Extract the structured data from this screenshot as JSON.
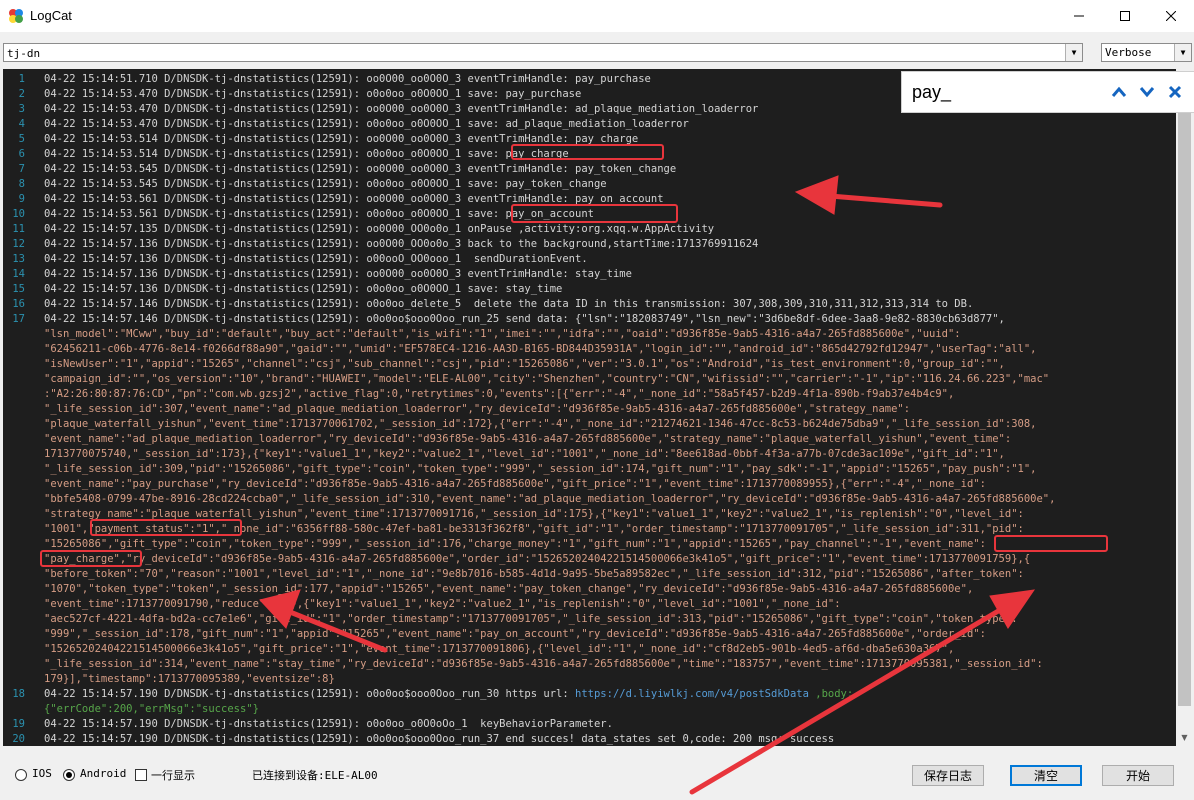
{
  "window": {
    "title": "LogCat"
  },
  "toolbar": {
    "device": "tj-dn",
    "level": "Verbose"
  },
  "find": {
    "query": "pay_"
  },
  "log": {
    "line_numbers": [
      "1",
      "2",
      "3",
      "4",
      "5",
      "6",
      "7",
      "8",
      "9",
      "10",
      "11",
      "12",
      "13",
      "14",
      "15",
      "16",
      "17",
      "18",
      "19",
      "20"
    ],
    "lines": [
      "04-22 15:14:51.710 D/DNSDK-tj-dnstatistics(12591): oo0O00_oo0O0O_3 eventTrimHandle: pay_purchase",
      "04-22 15:14:53.470 D/DNSDK-tj-dnstatistics(12591): o0o0oo_o0O0OO_1 save: pay_purchase",
      "04-22 15:14:53.470 D/DNSDK-tj-dnstatistics(12591): oo0O00_oo0O0O_3 eventTrimHandle: ad_plaque_mediation_loaderror",
      "04-22 15:14:53.470 D/DNSDK-tj-dnstatistics(12591): o0o0oo_o0O0OO_1 save: ad_plaque_mediation_loaderror",
      "04-22 15:14:53.514 D/DNSDK-tj-dnstatistics(12591): oo0O00_oo0O0O_3 eventTrimHandle: pay_charge",
      "04-22 15:14:53.514 D/DNSDK-tj-dnstatistics(12591): o0o0oo_o0O0OO_1 save: pay_charge",
      "04-22 15:14:53.545 D/DNSDK-tj-dnstatistics(12591): oo0O00_oo0O0O_3 eventTrimHandle: pay_token_change",
      "04-22 15:14:53.545 D/DNSDK-tj-dnstatistics(12591): o0o0oo_o0O0OO_1 save: pay_token_change",
      "04-22 15:14:53.561 D/DNSDK-tj-dnstatistics(12591): oo0O00_oo0O0O_3 eventTrimHandle: pay_on_account",
      "04-22 15:14:53.561 D/DNSDK-tj-dnstatistics(12591): o0o0oo_o0O0OO_1 save: pay_on_account",
      "04-22 15:14:57.135 D/DNSDK-tj-dnstatistics(12591): oo0O00_OO0o0o_1 onPause ,activity:org.xqq.w.AppActivity",
      "04-22 15:14:57.136 D/DNSDK-tj-dnstatistics(12591): oo0O00_OO0o0o_3 back to the background,startTime:1713769911624",
      "04-22 15:14:57.136 D/DNSDK-tj-dnstatistics(12591): o00ooO_OO0ooo_1  sendDurationEvent.",
      "04-22 15:14:57.136 D/DNSDK-tj-dnstatistics(12591): oo0O00_oo0O0O_3 eventTrimHandle: stay_time",
      "04-22 15:14:57.136 D/DNSDK-tj-dnstatistics(12591): o0o0oo_o0O0OO_1 save: stay_time",
      "04-22 15:14:57.146 D/DNSDK-tj-dnstatistics(12591): o0o0oo_delete_5  delete the data ID in this transmission: 307,308,309,310,311,312,313,314 to DB.",
      "04-22 15:14:57.146 D/DNSDK-tj-dnstatistics(12591): o0o0oo$ooo0Ooo_run_25 send data: {\"lsn\":\"182083749\",\"lsn_new\":\"3d6be8df-6dee-3aa8-9e82-8830cb63d877\","
    ],
    "json_lines": [
      "\"lsn_model\":\"MCww\",\"buy_id\":\"default\",\"buy_act\":\"default\",\"is_wifi\":\"1\",\"imei\":\"\",\"idfa\":\"\",\"oaid\":\"d936f85e-9ab5-4316-a4a7-265fd885600e\",\"uuid\":",
      "\"62456211-c06b-4776-8e14-f0266df88a90\",\"gaid\":\"\",\"umid\":\"EF578EC4-1216-AA3D-B165-BD844D35931A\",\"login_id\":\"\",\"android_id\":\"865d42792fd12947\",\"userTag\":\"all\",",
      "\"isNewUser\":\"1\",\"appid\":\"15265\",\"channel\":\"csj\",\"sub_channel\":\"csj\",\"pid\":\"15265086\",\"ver\":\"3.0.1\",\"os\":\"Android\",\"is_test_environment\":0,\"group_id\":\"\",",
      "\"campaign_id\":\"\",\"os_version\":\"10\",\"brand\":\"HUAWEI\",\"model\":\"ELE-AL00\",\"city\":\"Shenzhen\",\"country\":\"CN\",\"wifissid\":\"\",\"carrier\":\"-1\",\"ip\":\"116.24.66.223\",\"mac\"",
      ":\"A2:26:80:87:76:CD\",\"pn\":\"com.wb.gzsj2\",\"active_flag\":0,\"retrytimes\":0,\"events\":[{\"err\":\"-4\",\"_none_id\":\"58a5f457-b2d9-4f1a-890b-f9ab37e4b4c9\",",
      "\"_life_session_id\":307,\"event_name\":\"ad_plaque_mediation_loaderror\",\"ry_deviceId\":\"d936f85e-9ab5-4316-a4a7-265fd885600e\",\"strategy_name\":",
      "\"plaque_waterfall_yishun\",\"event_time\":1713770061702,\"_session_id\":172},{\"err\":\"-4\",\"_none_id\":\"21274621-1346-47cc-8c53-b624de75dba9\",\"_life_session_id\":308,",
      "\"event_name\":\"ad_plaque_mediation_loaderror\",\"ry_deviceId\":\"d936f85e-9ab5-4316-a4a7-265fd885600e\",\"strategy_name\":\"plaque_waterfall_yishun\",\"event_time\":",
      "1713770075740,\"_session_id\":173},{\"key1\":\"value1_1\",\"key2\":\"value2_1\",\"level_id\":\"1001\",\"_none_id\":\"8ee618ad-0bbf-4f3a-a77b-07cde3ac109e\",\"gift_id\":\"1\",",
      "\"_life_session_id\":309,\"pid\":\"15265086\",\"gift_type\":\"coin\",\"token_type\":\"999\",\"_session_id\":174,\"gift_num\":\"1\",\"pay_sdk\":\"-1\",\"appid\":\"15265\",\"pay_push\":\"1\",",
      "\"event_name\":\"pay_purchase\",\"ry_deviceId\":\"d936f85e-9ab5-4316-a4a7-265fd885600e\",\"gift_price\":\"1\",\"event_time\":1713770089955},{\"err\":\"-4\",\"_none_id\":",
      "\"bbfe5408-0799-47be-8916-28cd224ccba0\",\"_life_session_id\":310,\"event_name\":\"ad_plaque_mediation_loaderror\",\"ry_deviceId\":\"d936f85e-9ab5-4316-a4a7-265fd885600e\",",
      "\"strategy_name\":\"plaque_waterfall_yishun\",\"event_time\":1713770091716,\"_session_id\":175},{\"key1\":\"value1_1\",\"key2\":\"value2_1\",\"is_replenish\":\"0\",\"level_id\":",
      "\"1001\",\"payment_status\":\"1\",\"_none_id\":\"6356ff88-580c-47ef-ba81-be3313f362f8\",\"gift_id\":\"1\",\"order_timestamp\":\"1713770091705\",\"_life_session_id\":311,\"pid\":",
      "\"15265086\",\"gift_type\":\"coin\",\"token_type\":\"999\",\"_session_id\":176,\"charge_money\":\"1\",\"gift_num\":\"1\",\"appid\":\"15265\",\"pay_channel\":\"-1\",\"event_name\":",
      "\"pay_charge\",\"ry_deviceId\":\"d936f85e-9ab5-4316-a4a7-265fd885600e\",\"order_id\":\"15265202404221514500066e3k41o5\",\"gift_price\":\"1\",\"event_time\":1713770091759},{",
      "\"before_token\":\"70\",\"reason\":\"1001\",\"level_id\":\"1\",\"_none_id\":\"9e8b7016-b585-4d1d-9a95-5be5a89582ec\",\"_life_session_id\":312,\"pid\":\"15265086\",\"after_token\":",
      "\"1070\",\"token_type\":\"token\",\"_session_id\":177,\"appid\":\"15265\",\"event_name\":\"pay_token_change\",\"ry_deviceId\":\"d936f85e-9ab5-4316-a4a7-265fd885600e\",",
      "\"event_time\":1713770091790,\"reduce\":\"1\"},{\"key1\":\"value1_1\",\"key2\":\"value2_1\",\"is_replenish\":\"0\",\"level_id\":\"1001\",\"_none_id\":",
      "\"aec527cf-4221-4dfa-bd2a-cc7e1e6\",\"gift_id\":\"1\",\"order_timestamp\":\"1713770091705\",\"_life_session_id\":313,\"pid\":\"15265086\",\"gift_type\":\"coin\",\"token_type\":",
      "\"999\",\"_session_id\":178,\"gift_num\":\"1\",\"appid\":\"15265\",\"event_name\":\"pay_on_account\",\"ry_deviceId\":\"d936f85e-9ab5-4316-a4a7-265fd885600e\",\"order_id\":",
      "\"15265202404221514500066e3k41o5\",\"gift_price\":\"1\",\"event_time\":1713770091806},{\"level_id\":\"1\",\"_none_id\":\"cf8d2eb5-901b-4ed5-af6d-dba5e630a367\",",
      "\"_life_session_id\":314,\"event_name\":\"stay_time\",\"ry_deviceId\":\"d936f85e-9ab5-4316-a4a7-265fd885600e\",\"time\":\"183757\",\"event_time\":1713770095381,\"_session_id\":",
      "179}],\"timestamp\":1713770095389,\"eventsize\":8}"
    ],
    "line18_a": "04-22 15:14:57.190 D/DNSDK-tj-dnstatistics(12591): o0o0oo$ooo0Ooo_run_30 https url: ",
    "line18_url": "https://d.liyiwlkj.com/v4/postSdkData",
    "line18_b": " ,body:",
    "line18_json": "{\"errCode\":200,\"errMsg\":\"success\"}",
    "line19": "04-22 15:14:57.190 D/DNSDK-tj-dnstatistics(12591): o0o0oo_o0O0oOo_1  keyBehaviorParameter.",
    "line20": "04-22 15:14:57.190 D/DNSDK-tj-dnstatistics(12591): o0o0oo$ooo0Ooo_run_37 end succes! data_states set 0,code: 200 msg: success"
  },
  "status": {
    "ios_label": "IOS",
    "android_label": "Android",
    "oneline_label": "一行显示",
    "connection": "已连接到设备:ELE-AL00",
    "save_log": "保存日志",
    "clear": "清空",
    "start": "开始"
  },
  "colors": {
    "highlight": "#e8353c",
    "log_bg": "#1e1e1e",
    "json_text": "#d69d85",
    "line_number": "#2b91af"
  }
}
